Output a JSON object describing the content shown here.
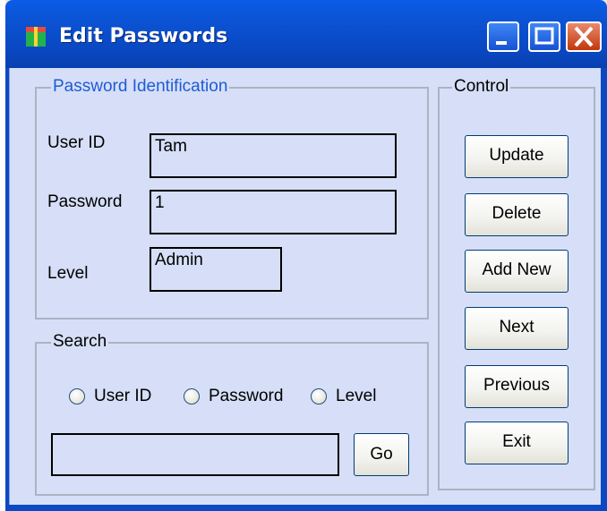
{
  "window": {
    "title": "Edit Passwords"
  },
  "identification": {
    "legend": "Password Identification",
    "user_id_label": "User ID",
    "user_id_value": "Tam",
    "password_label": "Password",
    "password_value": "1",
    "level_label": "Level",
    "level_value": "Admin"
  },
  "search": {
    "legend": "Search",
    "options": [
      "User ID",
      "Password",
      "Level"
    ],
    "query_value": "",
    "go_label": "Go"
  },
  "control": {
    "legend": "Control",
    "buttons": [
      "Update",
      "Delete",
      "Add New",
      "Next",
      "Previous",
      "Exit"
    ]
  }
}
